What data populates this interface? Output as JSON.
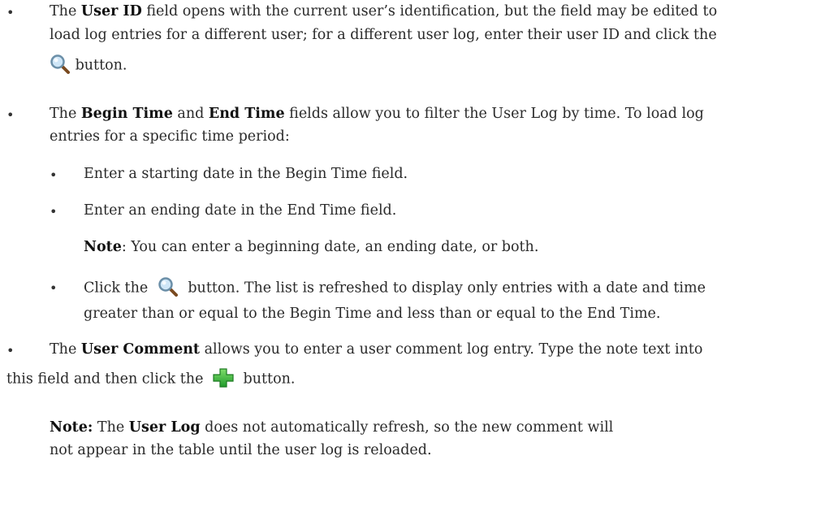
{
  "bullets": {
    "user_id": {
      "pre": "The ",
      "label": "User ID",
      "line1_rest": " field opens with the current user’s identification, but the field may be edited to",
      "line2": "load log entries for a different user; for a different user log, enter their user ID  and click the",
      "line3_after_icon": " button.",
      "icon": "search-icon"
    },
    "time_filter": {
      "pre": "The ",
      "begin_label": "Begin Time",
      "mid": " and ",
      "end_label": "End Time",
      "line1_rest": " fields allow you to filter the User Log by time. To load log",
      "line2": "entries for a specific time period:",
      "sub_items": [
        "Enter a starting date in the Begin Time field.",
        "Enter an ending date in the End Time field."
      ],
      "note_label": "Note",
      "note_text": ": You can enter a beginning date, an ending date, or both.",
      "click_pre": "Click the ",
      "click_icon": "search-icon",
      "click_rest": " button. The list is refreshed to display only entries with a date and time",
      "click_line2": "greater than or equal to the Begin Time and less than or equal to the End Time."
    },
    "user_comment": {
      "pre": "The ",
      "label": "User Comment",
      "line1_rest": " allows you to enter a user comment log entry. Type the note text into",
      "line2_pre": "this field and then click the ",
      "icon": "add-plus-icon",
      "line2_post": " button."
    }
  },
  "note_block": {
    "label": "Note:",
    "text_pre": " The ",
    "user_log": "User Log",
    "text_post": " does not automatically refresh, so the new comment will",
    "line2": "not appear in the table until the user log is reloaded."
  },
  "colors": {
    "text": "#2a2a2a",
    "bold": "#111111",
    "plus_green": "#2fa82f"
  }
}
